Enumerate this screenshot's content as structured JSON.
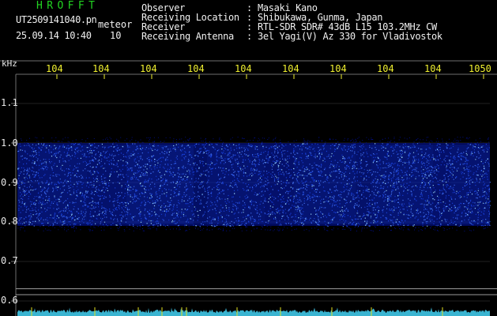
{
  "header": {
    "app_name": "HROFFT",
    "file_name": "UT2509141040.pn",
    "meteor_label": "meteor",
    "timestamp": "25.09.14 10:40",
    "scale_value": "10"
  },
  "metadata": [
    {
      "key": "Observer",
      "sep": ":",
      "value": "Masaki Kano"
    },
    {
      "key": "Receiving Location",
      "sep": ":",
      "value": "Shibukawa, Gunma, Japan"
    },
    {
      "key": "Receiver",
      "sep": ":",
      "value": "RTL-SDR SDR# 43dB L15 103.2MHz CW"
    },
    {
      "key": "Receiving Antenna",
      "sep": ":",
      "value": "3el Yagi(V) Az 330 for Vladivostok"
    }
  ],
  "spectrogram": {
    "freq_unit": "kHz",
    "x_tick_labels": [
      "104",
      "104",
      "104",
      "104",
      "104",
      "104",
      "104",
      "104",
      "104",
      "1050"
    ],
    "y_tick_labels": [
      "1.1",
      "1.0",
      "0.9",
      "0.8",
      "0.7",
      "0.6"
    ],
    "y_ticks": [
      1.1,
      1.0,
      0.9,
      0.8,
      0.7,
      0.6
    ],
    "y_range": [
      0.6,
      1.1
    ],
    "signal_band": [
      0.79,
      1.0
    ],
    "reference_lines": [
      0.625,
      0.61
    ],
    "colors": {
      "background": "#000000",
      "grid": "#6e6e6e",
      "tick": "#f0f030",
      "signal_low": "#0010a0",
      "signal_mid": "#2050ff",
      "signal_high": "#a0e0ff",
      "baseline": "#40c8e8",
      "marker": "#e0e020",
      "app_name": "#22d422"
    }
  }
}
